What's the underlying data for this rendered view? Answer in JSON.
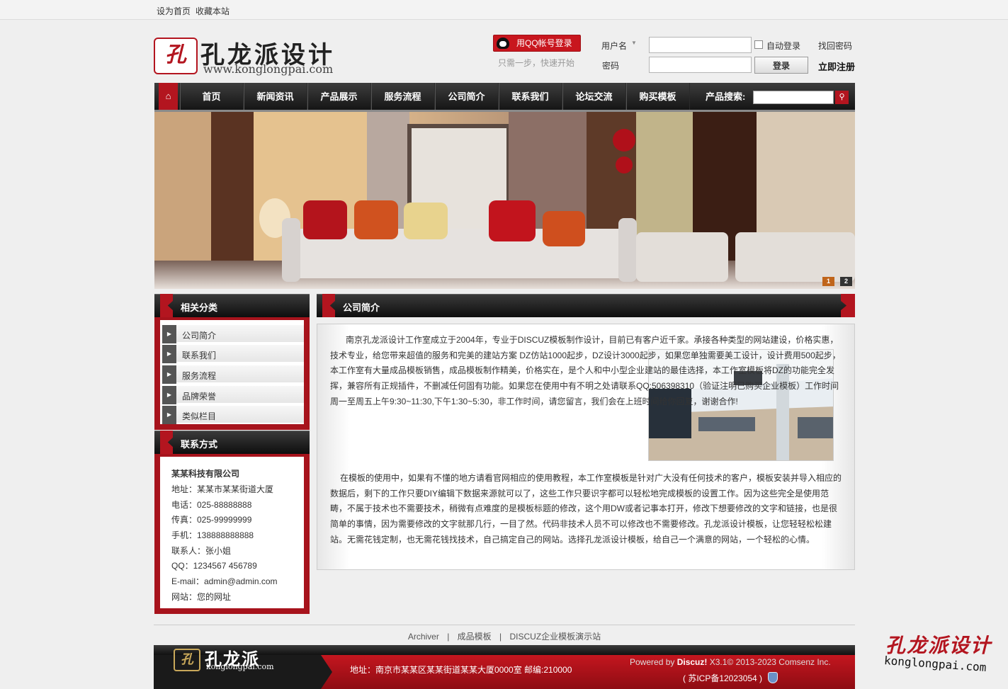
{
  "topbar": {
    "set_home": "设为首页",
    "bookmark": "收藏本站"
  },
  "logo": {
    "seal": "孔",
    "name": "孔龙派设计",
    "url": "www.konglongpai.com"
  },
  "qq_login": {
    "label": "用QQ帐号登录",
    "sub": "只需一步，快速开始"
  },
  "login": {
    "username_label": "用户名",
    "password_label": "密码",
    "auto_login": "自动登录",
    "forgot": "找回密码",
    "submit": "登录",
    "register": "立即注册"
  },
  "nav": {
    "items": [
      "首页",
      "新闻资讯",
      "产品展示",
      "服务流程",
      "公司简介",
      "联系我们",
      "论坛交流",
      "购买模板"
    ],
    "search_label": "产品搜索:"
  },
  "banner": {
    "pages": [
      "1",
      "2"
    ]
  },
  "sidebar": {
    "category_title": "相关分类",
    "categories": [
      "公司简介",
      "联系我们",
      "服务流程",
      "品牌荣誉",
      "类似栏目"
    ],
    "contact_title": "联系方式",
    "company": "某某科技有限公司",
    "address": "地址：某某市某某街道大厦",
    "phone": "电话：025-88888888",
    "fax": "传真：025-99999999",
    "mobile": "手机：138888888888",
    "contact": "联系人：张小姐",
    "qq": "QQ：1234567 456789",
    "email": "E-mail：admin@admin.com",
    "website": "网站：您的网址"
  },
  "main": {
    "title": "公司简介",
    "para1": "南京孔龙派设计工作室成立于2004年，专业于DISCUZ模板制作设计，目前已有客户近千家。承接各种类型的网站建设，价格实惠，技术专业，给您带来超值的服务和完美的建站方案 DZ仿站1000起步，DZ设计3000起步，如果您单独需要美工设计，设计费用500起步，本工作室有大量成品模板销售，成品模板制作精美，价格实在，是个人和中小型企业建站的最佳选择，本工作室模板将DZ的功能完全发挥，兼容所有正规插件，不删减任何固有功能。如果您在使用中有不明之处请联系QQ:506398310（验证注明已购买企业模板）工作时间周一至周五上午9:30~11:30,下午1:30~5:30，非工作时间，请您留言，我们会在上班时间给你回复，谢谢合作!",
    "para2": "在模板的使用中，如果有不懂的地方请看官网相应的使用教程，本工作室模板是针对广大没有任何技术的客户，模板安装并导入相应的数据后，剩下的工作只要DIY编辑下数据来源就可以了，这些工作只要识字都可以轻松地完成模板的设置工作。因为这些完全是使用范畴，不属于技术也不需要技术，稍微有点难度的是模板标题的修改，这个用DW或者记事本打开，修改下想要修改的文字和链接，也是很简单的事情，因为需要修改的文字就那几行，一目了然。代码非技术人员不可以修改也不需要修改。孔龙派设计模板，让您轻轻松松建站。无需花钱定制，也无需花钱找技术，自己搞定自己的网站。选择孔龙派设计模板，给自己一个满意的网站，一个轻松的心情。"
  },
  "footer": {
    "links": [
      "Archiver",
      "成品模板",
      "DISCUZ企业模板演示站"
    ],
    "sep": "|",
    "logo_name": "孔龙派",
    "logo_url": "konglongpai.com",
    "address": "地址：南京市某某区某某街道某某大厦0000室 邮编:210000",
    "powered_prefix": "Powered by ",
    "powered_brand": "Discuz!",
    "powered_suffix": " X3.1© 2013-2023 Comsenz Inc.",
    "icp": "( 苏ICP备12023054 )"
  },
  "watermark": {
    "name": "孔龙派设计",
    "url": "konglongpai.com"
  },
  "colors": {
    "brand_red": "#b3151f",
    "nav_dark": "#1e1e1e"
  }
}
